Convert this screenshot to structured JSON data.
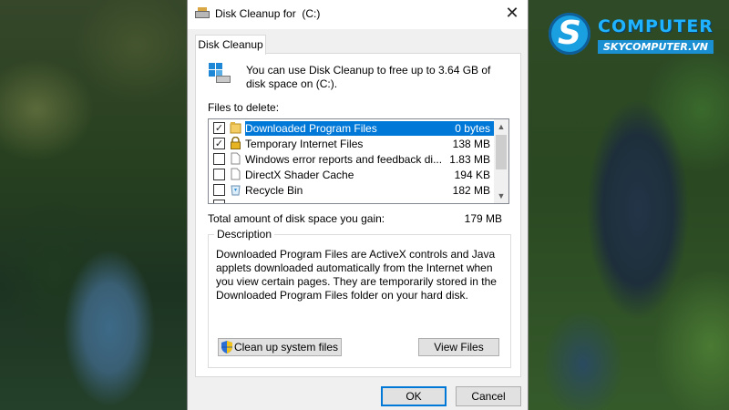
{
  "window": {
    "title": "Disk Cleanup for  (C:)",
    "tab_label": "Disk Cleanup",
    "intro_text": "You can use Disk Cleanup to free up to 3.64 GB of disk space on  (C:)."
  },
  "files": {
    "label": "Files to delete:",
    "items": [
      {
        "name": "Downloaded Program Files",
        "size": "0 bytes",
        "checked": true,
        "selected": true,
        "icon": "folder-icon"
      },
      {
        "name": "Temporary Internet Files",
        "size": "138 MB",
        "checked": true,
        "selected": false,
        "icon": "lock-icon"
      },
      {
        "name": "Windows error reports and feedback di...",
        "size": "1.83 MB",
        "checked": false,
        "selected": false,
        "icon": "document-icon"
      },
      {
        "name": "DirectX Shader Cache",
        "size": "194 KB",
        "checked": false,
        "selected": false,
        "icon": "document-icon"
      },
      {
        "name": "Recycle Bin",
        "size": "182 MB",
        "checked": false,
        "selected": false,
        "icon": "recycle-bin-icon"
      }
    ]
  },
  "total": {
    "label": "Total amount of disk space you gain:",
    "value": "179 MB"
  },
  "description": {
    "legend": "Description",
    "text": "Downloaded Program Files are ActiveX controls and Java applets downloaded automatically from the Internet when you view certain pages. They are temporarily stored in the Downloaded Program Files folder on your hard disk."
  },
  "buttons": {
    "cleanup_system": "Clean up system files",
    "view_files": "View Files",
    "ok": "OK",
    "cancel": "Cancel",
    "close_glyph": "✕"
  },
  "logo": {
    "word": "COMPUTER",
    "sub": "SKYCOMPUTER.VN",
    "mark": "S"
  },
  "colors": {
    "accent": "#0078d7",
    "logo_blue": "#1a9fe0"
  }
}
